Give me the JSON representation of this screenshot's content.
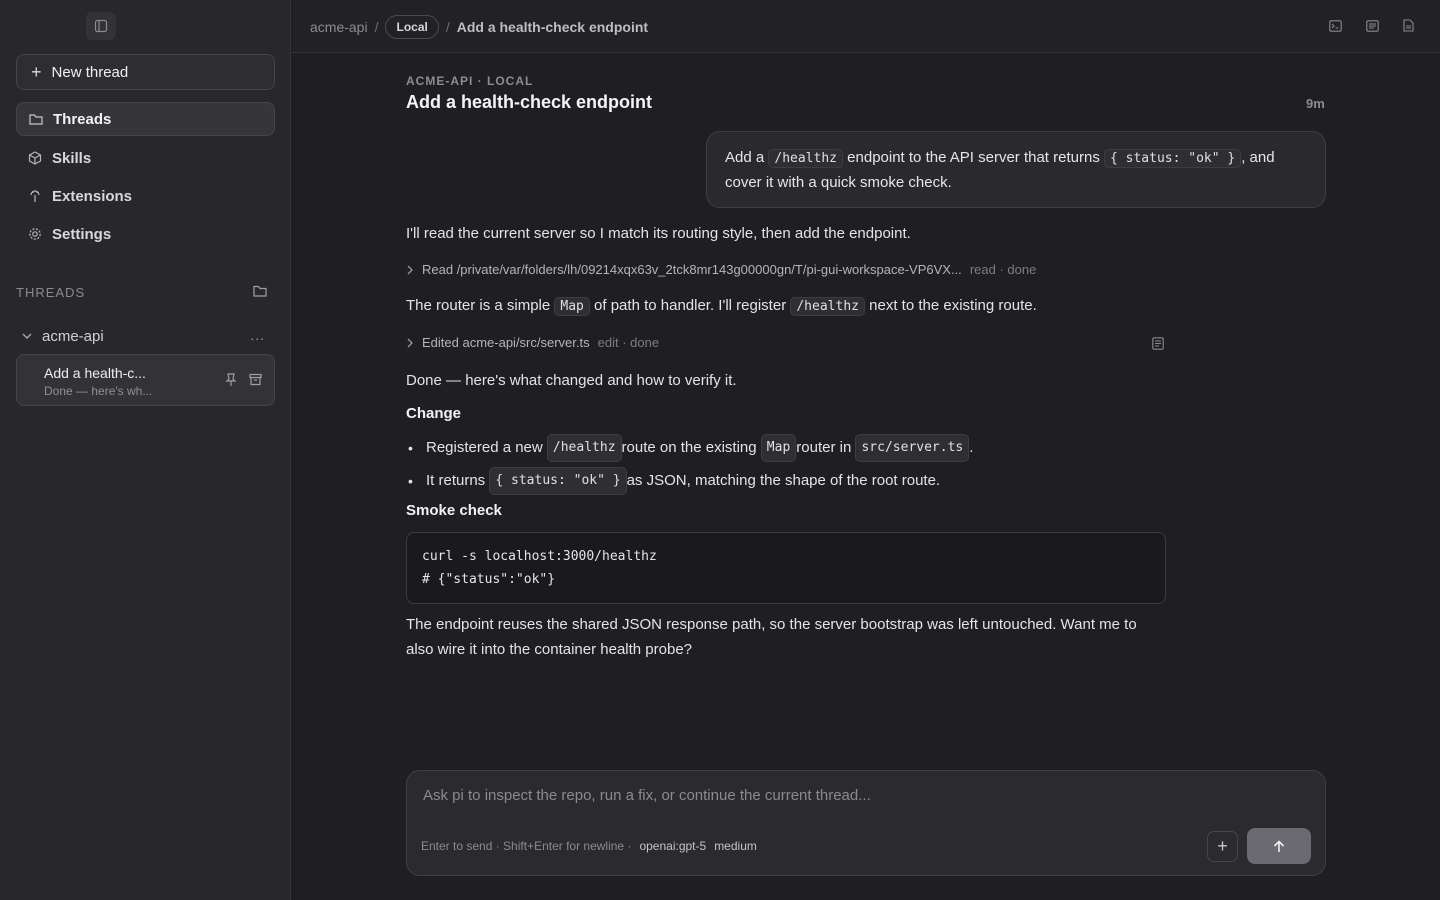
{
  "sidebar": {
    "new_thread_label": "New thread",
    "nav": [
      {
        "label": "Threads",
        "icon": "folder-icon",
        "active": true
      },
      {
        "label": "Skills",
        "icon": "cube-icon"
      },
      {
        "label": "Extensions",
        "icon": "plug-icon"
      },
      {
        "label": "Settings",
        "icon": "gear-icon"
      }
    ],
    "section_label": "THREADS",
    "group_name": "acme-api",
    "group_more": "...",
    "thread": {
      "title": "Add a health-c...",
      "subtitle": "Done — here's wh..."
    }
  },
  "header": {
    "crumb_root": "acme-api",
    "crumb_sep": "/",
    "crumb_pill": "Local",
    "crumb_current": "Add a health-check endpoint"
  },
  "main": {
    "eyebrow": "ACME-API · LOCAL",
    "title": "Add a health-check endpoint",
    "time_ago": "9m",
    "user_msg": {
      "t1": "Add a ",
      "c1": "/healthz",
      "t2": " endpoint to the API server that returns ",
      "c2": "{ status: \"ok\" }",
      "t3": ", and",
      "t4": "cover it with a quick smoke check."
    },
    "p1": "I'll read the current server so I match its routing style, then add the endpoint.",
    "tool1": {
      "label": "Read /private/var/folders/lh/09214xqx63v_2tck8mr143g00000gn/T/pi-gui-workspace-VP6VX...",
      "meta": "read · done"
    },
    "p2": {
      "t1": "The router is a simple ",
      "c1": "Map",
      "t2": " of path to handler. I'll register ",
      "c2": "/healthz",
      "t3": " next to the existing route."
    },
    "tool2": {
      "label": "Edited acme-api/src/server.ts",
      "meta": "edit · done"
    },
    "p3": "Done — here's what changed and how to verify it.",
    "h_change": "Change",
    "bullet1": {
      "t1": "Registered a new ",
      "c1": "/healthz",
      "t2": " route on the existing ",
      "c2": "Map",
      "t3": " router in ",
      "c3": "src/server.ts",
      "t4": "."
    },
    "bullet2": {
      "t1": "It returns ",
      "c1": "{ status: \"ok\" }",
      "t2": " as JSON, matching the shape of the root route."
    },
    "h_smoke": "Smoke check",
    "code_line1": "curl -s localhost:3000/healthz",
    "code_line2": "# {\"status\":\"ok\"}",
    "p4_line1": "The endpoint reuses the shared JSON response path, so the server bootstrap was left untouched. Want me to",
    "p4_line2": "also wire it into the container health probe?"
  },
  "composer": {
    "placeholder": "Ask pi to inspect the repo, run a fix, or continue the current thread...",
    "hint": "Enter to send · Shift+Enter for newline ·",
    "model": "openai:gpt-5",
    "effort": "medium",
    "plus": "+"
  }
}
